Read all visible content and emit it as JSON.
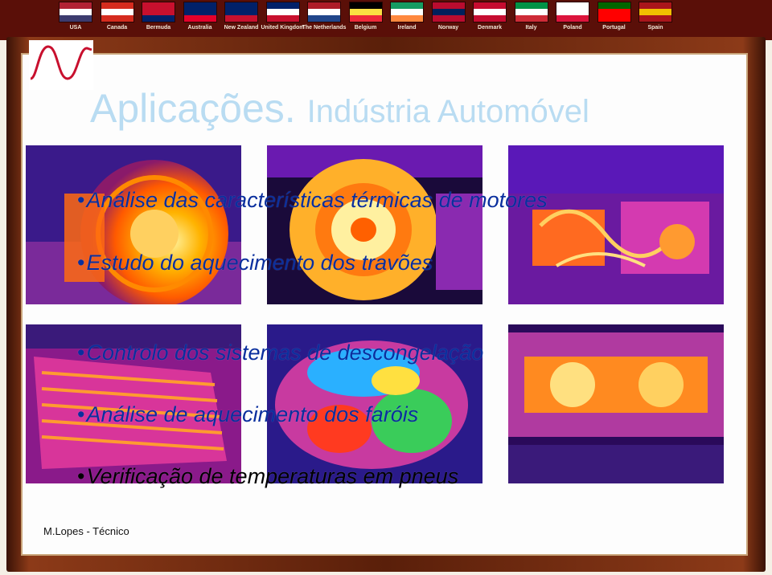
{
  "flags": [
    {
      "name": "USA",
      "colors": [
        "#b22234",
        "#ffffff",
        "#3c3b6e"
      ]
    },
    {
      "name": "Canada",
      "colors": [
        "#d52b1e",
        "#ffffff",
        "#d52b1e"
      ]
    },
    {
      "name": "Bermuda",
      "colors": [
        "#c8102e",
        "#c8102e",
        "#012169"
      ]
    },
    {
      "name": "Australia",
      "colors": [
        "#012169",
        "#012169",
        "#e4002b"
      ]
    },
    {
      "name": "New Zealand",
      "colors": [
        "#012169",
        "#012169",
        "#c8102e"
      ]
    },
    {
      "name": "United Kingdom",
      "colors": [
        "#012169",
        "#ffffff",
        "#c8102e"
      ]
    },
    {
      "name": "The Netherlands",
      "colors": [
        "#ae1c28",
        "#ffffff",
        "#21468b"
      ]
    },
    {
      "name": "Belgium",
      "colors": [
        "#000000",
        "#fae042",
        "#ed2939"
      ]
    },
    {
      "name": "Ireland",
      "colors": [
        "#169b62",
        "#ffffff",
        "#ff883e"
      ]
    },
    {
      "name": "Norway",
      "colors": [
        "#ba0c2f",
        "#00205b",
        "#ba0c2f"
      ]
    },
    {
      "name": "Denmark",
      "colors": [
        "#c60c30",
        "#ffffff",
        "#c60c30"
      ]
    },
    {
      "name": "Italy",
      "colors": [
        "#009246",
        "#ffffff",
        "#ce2b37"
      ]
    },
    {
      "name": "Poland",
      "colors": [
        "#ffffff",
        "#ffffff",
        "#dc143c"
      ]
    },
    {
      "name": "Portugal",
      "colors": [
        "#006600",
        "#ff0000",
        "#ff0000"
      ]
    },
    {
      "name": "Spain",
      "colors": [
        "#aa151b",
        "#f1bf00",
        "#aa151b"
      ]
    }
  ],
  "title": {
    "main": "Aplicações.",
    "sub": "Indústria Automóvel"
  },
  "bullets": [
    {
      "text": "Análise das características térmicas de motores",
      "color": "blue"
    },
    {
      "text": "Estudo do aquecimento dos travões",
      "color": "blue"
    },
    {
      "text": "Controlo dos sistemas de descongelação",
      "color": "blue"
    },
    {
      "text": "Análise de aquecimento dos faróis",
      "color": "blue"
    },
    {
      "text": "Verificação de temperaturas em pneus",
      "color": "black"
    }
  ],
  "images": [
    {
      "name": "brake-disc-thermal-image"
    },
    {
      "name": "tire-thermal-image"
    },
    {
      "name": "engine-thermal-image"
    },
    {
      "name": "rear-window-defrost-thermal-image"
    },
    {
      "name": "volvo-engine-thermal-image"
    },
    {
      "name": "headlight-thermal-image"
    }
  ],
  "footer": "M.Lopes - Técnico"
}
